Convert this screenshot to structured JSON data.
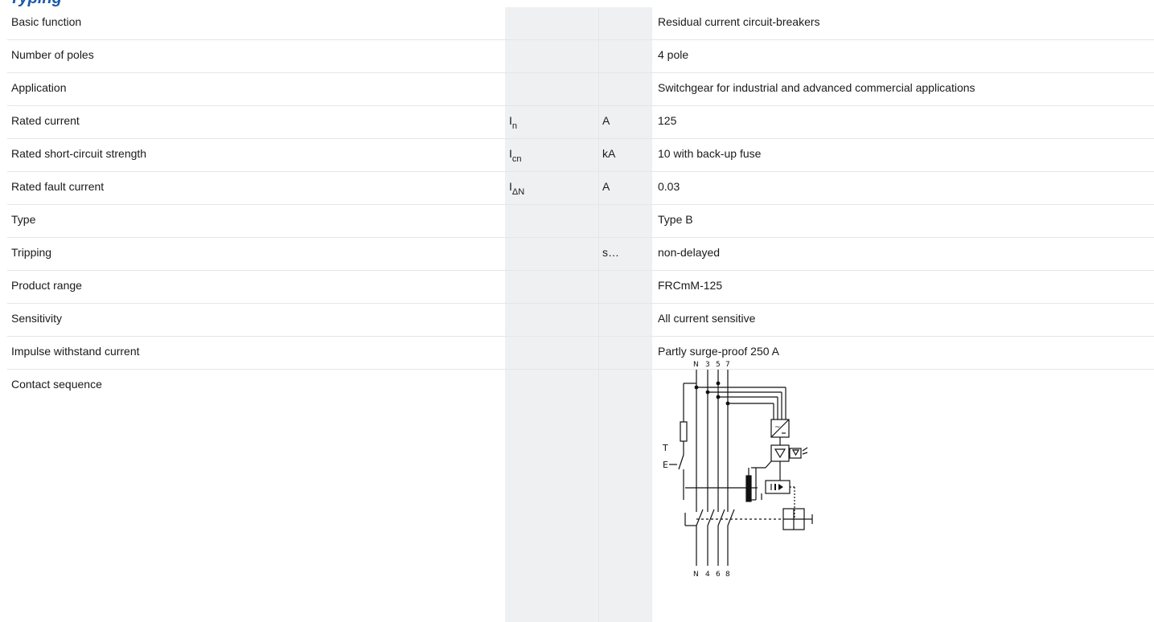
{
  "page": {
    "title_fragment": "Typing"
  },
  "rows": [
    {
      "label": "Basic function",
      "symbol": "",
      "symbol_sub": "",
      "unit": "",
      "value": "Residual current circuit-breakers"
    },
    {
      "label": "Number of poles",
      "symbol": "",
      "symbol_sub": "",
      "unit": "",
      "value": "4 pole"
    },
    {
      "label": "Application",
      "symbol": "",
      "symbol_sub": "",
      "unit": "",
      "value": "Switchgear for industrial and advanced commercial applications"
    },
    {
      "label": "Rated current",
      "symbol": "I",
      "symbol_sub": "n",
      "unit": "A",
      "value": "125"
    },
    {
      "label": "Rated short-circuit strength",
      "symbol": "I",
      "symbol_sub": "cn",
      "unit": "kA",
      "value": "10 with back-up fuse"
    },
    {
      "label": "Rated fault current",
      "symbol": "I",
      "symbol_sub": "ΔN",
      "unit": "A",
      "value": "0.03"
    },
    {
      "label": "Type",
      "symbol": "",
      "symbol_sub": "",
      "unit": "",
      "value": "Type B"
    },
    {
      "label": "Tripping",
      "symbol": "",
      "symbol_sub": "",
      "unit": "s…",
      "value": "non-delayed"
    },
    {
      "label": "Product range",
      "symbol": "",
      "symbol_sub": "",
      "unit": "",
      "value": "FRCmM-125"
    },
    {
      "label": "Sensitivity",
      "symbol": "",
      "symbol_sub": "",
      "unit": "",
      "value": "All current sensitive"
    },
    {
      "label": "Impulse withstand current",
      "symbol": "",
      "symbol_sub": "",
      "unit": "",
      "value": "Partly surge-proof 250 A"
    },
    {
      "label": "Contact sequence",
      "symbol": "",
      "symbol_sub": "",
      "unit": "",
      "value": ""
    }
  ],
  "diagram": {
    "top_terminals": [
      "N",
      "3",
      "5",
      "7"
    ],
    "bottom_terminals": [
      "N",
      "4",
      "6",
      "8"
    ],
    "test_label": [
      "T",
      "E"
    ]
  }
}
